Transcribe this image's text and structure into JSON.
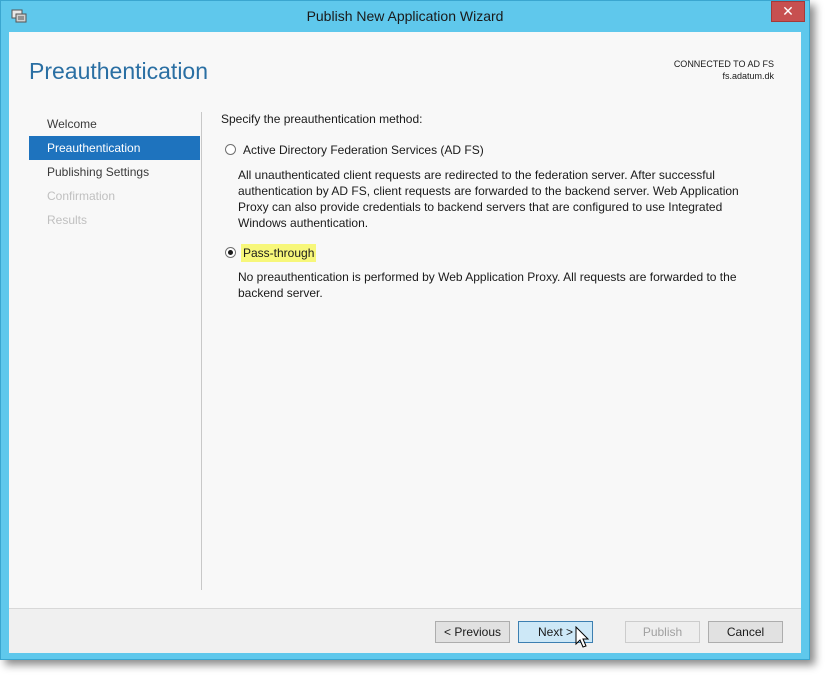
{
  "window": {
    "title": "Publish New Application Wizard",
    "close_label": "✕"
  },
  "header": {
    "page_title": "Preauthentication",
    "connected_label": "CONNECTED TO AD FS",
    "server": "fs.adatum.dk"
  },
  "nav": {
    "items": [
      {
        "label": "Welcome",
        "state": "normal"
      },
      {
        "label": "Preauthentication",
        "state": "active"
      },
      {
        "label": "Publishing Settings",
        "state": "normal"
      },
      {
        "label": "Confirmation",
        "state": "disabled"
      },
      {
        "label": "Results",
        "state": "disabled"
      }
    ]
  },
  "content": {
    "prompt": "Specify the preauthentication method:",
    "options": [
      {
        "label": "Active Directory Federation Services (AD FS)",
        "selected": false,
        "description": "All unauthenticated client requests are redirected to the federation server. After successful authentication by AD FS, client requests are forwarded to the backend server. Web Application Proxy can also provide credentials to backend servers that are configured to use Integrated Windows authentication."
      },
      {
        "label": "Pass-through",
        "selected": true,
        "highlighted": true,
        "description": "No preauthentication is performed by Web Application Proxy. All requests are forwarded to the backend server."
      }
    ]
  },
  "footer": {
    "previous_label": "< Previous",
    "next_label": "Next >",
    "publish_label": "Publish",
    "cancel_label": "Cancel"
  },
  "colors": {
    "window_frame": "#5fc8ec",
    "accent": "#1e73be",
    "heading": "#2a6fa3",
    "highlight": "#f7f77a"
  }
}
